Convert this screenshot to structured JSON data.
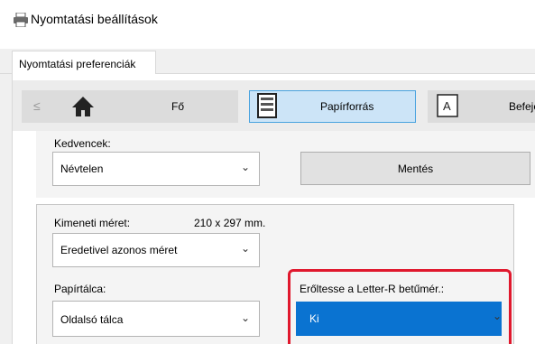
{
  "window": {
    "title": "Nyomtatási beállítások",
    "icon": "printer-icon"
  },
  "tabs": [
    {
      "label": "Nyomtatási preferenciák",
      "active": true
    }
  ],
  "toolbar": {
    "back_label": "≤",
    "items": [
      {
        "label": "Fő",
        "icon": "home-icon",
        "selected": false
      },
      {
        "label": "Papírforrás",
        "icon": "paper-tray-icon",
        "selected": true
      },
      {
        "label": "Befeje",
        "icon": "finishing-icon",
        "selected": false
      }
    ]
  },
  "favorites": {
    "label": "Kedvencek:",
    "value": "Névtelen",
    "save_label": "Mentés"
  },
  "output_size": {
    "label": "Kimeneti méret:",
    "value_text": "210 x 297 mm.",
    "selected": "Eredetivel azonos méret"
  },
  "paper_tray": {
    "label": "Papírtálca:",
    "selected": "Oldalsó tálca"
  },
  "letter_r": {
    "label": "Erőltesse a Letter-R betűmér.:",
    "selected": "Ki",
    "highlight_color": "#e0182d",
    "selection_color": "#0a73d1"
  },
  "colors": {
    "accent_selected_tab": "#cce4f7",
    "accent_border": "#4aa3df"
  }
}
